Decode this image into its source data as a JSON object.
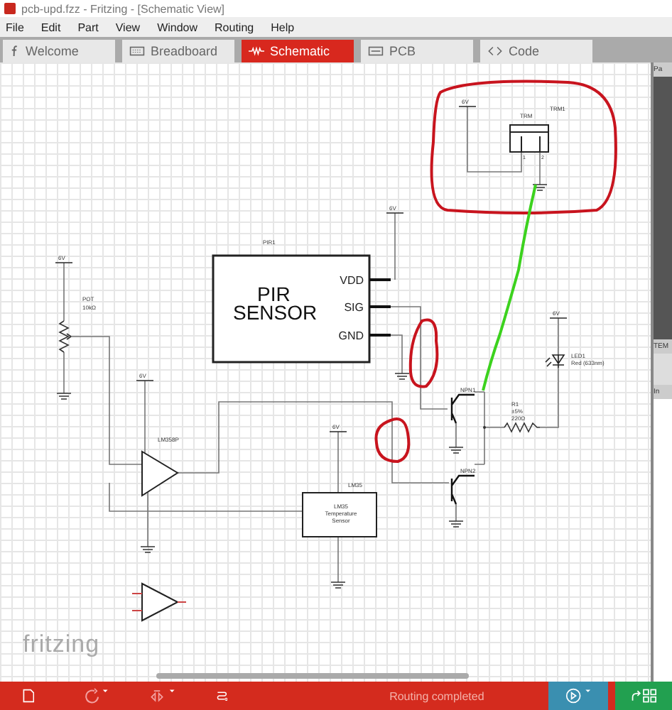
{
  "window": {
    "title": "pcb-upd.fzz - Fritzing - [Schematic View]"
  },
  "menu": [
    "File",
    "Edit",
    "Part",
    "View",
    "Window",
    "Routing",
    "Help"
  ],
  "tabs": [
    {
      "label": "Welcome",
      "kind": "welcome",
      "selected": false
    },
    {
      "label": "Breadboard",
      "kind": "breadboard",
      "selected": false
    },
    {
      "label": "Schematic",
      "kind": "schematic",
      "selected": true
    },
    {
      "label": "PCB",
      "kind": "pcb",
      "selected": false
    },
    {
      "label": "Code",
      "kind": "code",
      "selected": false
    }
  ],
  "schematic": {
    "supply_labels": [
      "6V",
      "6V",
      "6V",
      "6V",
      "6V",
      "6V"
    ],
    "trimmer": {
      "name": "TRM1",
      "label": "TRM",
      "pins": [
        "1",
        "2"
      ]
    },
    "pir": {
      "name": "PIR1",
      "title_lines": [
        "PIR",
        "SENSOR"
      ],
      "pins": [
        "VDD",
        "SIG",
        "GND"
      ]
    },
    "pot": {
      "name": "POT",
      "value": "10kΩ"
    },
    "opamp": {
      "name": "LM358P"
    },
    "temp_sensor": {
      "name": "LM35",
      "body_lines": [
        "LM35",
        "Temperature",
        "Sensor"
      ]
    },
    "transistors": [
      "NPN1",
      "NPN2"
    ],
    "resistor": {
      "name": "R1",
      "lines": [
        "±5%",
        "220Ω"
      ]
    },
    "led": {
      "name": "LED1",
      "value": "Red (633nm)"
    }
  },
  "logo": "fritzing",
  "side_panel": [
    "Pa",
    "TEM",
    "In"
  ],
  "status": "Routing completed"
}
